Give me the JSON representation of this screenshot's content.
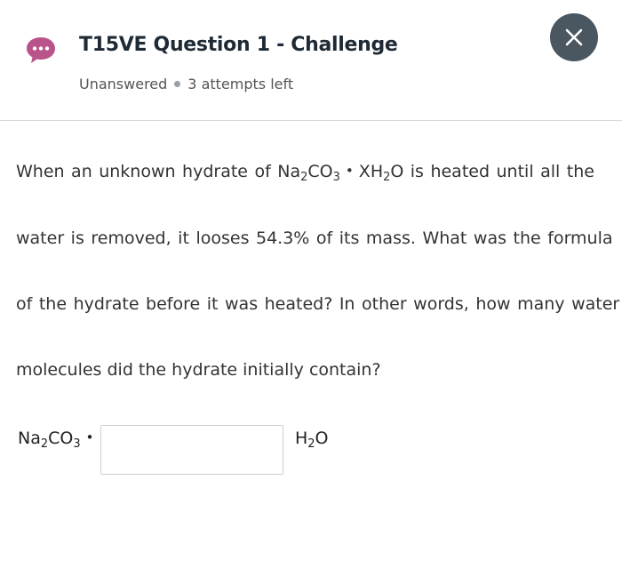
{
  "header": {
    "title": "T15VE Question 1 - Challenge",
    "status": "Unanswered",
    "attempts": "3 attempts left",
    "chat_icon_color": "#b9548a",
    "close_button_color": "#4a5660"
  },
  "question": {
    "line1_words": [
      "When",
      "an",
      "unknown",
      "hydrate",
      "of"
    ],
    "formula_na": "Na",
    "formula_sub2": "2",
    "formula_co": "CO",
    "formula_sub3": "3",
    "bullet": "•",
    "formula_xh": "XH",
    "formula_o": "O",
    "line1_tail_words": [
      "is",
      "heated",
      "until",
      "all",
      "the"
    ],
    "line2": "water is removed, it looses 54.3% of its mass. What was the formula",
    "line3": "of the hydrate before it was heated? In other words, how many water",
    "line4": "molecules did the hydrate initially contain?"
  },
  "answer": {
    "left_na": "Na",
    "left_sub2": "2",
    "left_co": "CO",
    "left_sub3": "3",
    "left_bullet": "•",
    "input_value": "",
    "right_h": "H",
    "right_sub2": "2",
    "right_o": "O"
  }
}
